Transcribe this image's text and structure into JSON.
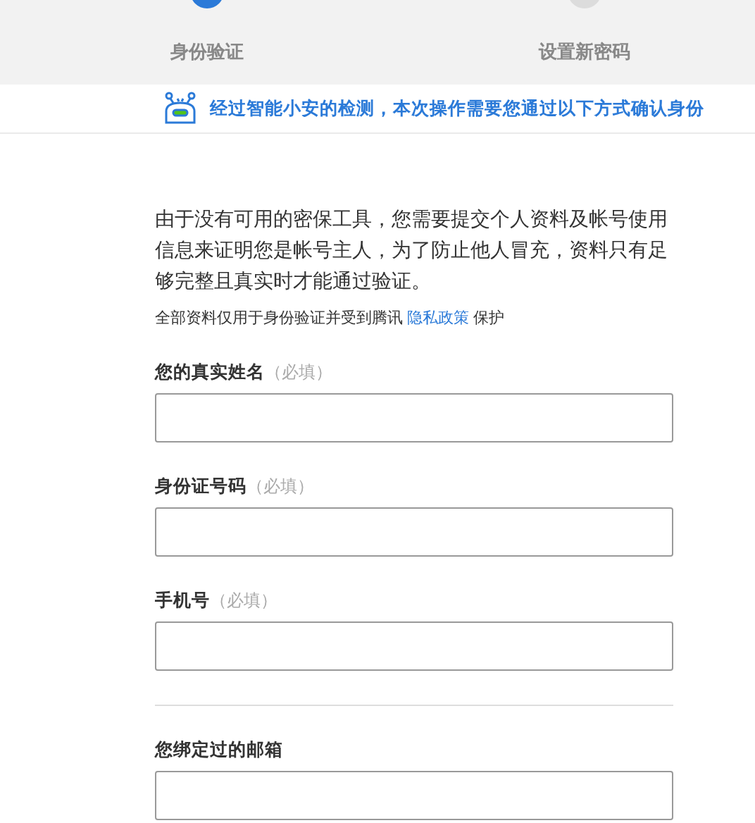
{
  "steps": [
    {
      "label": "身份验证",
      "selected": true
    },
    {
      "label": "设置新密码",
      "selected": false
    }
  ],
  "notice": {
    "text": "经过智能小安的检测，本次操作需要您通过以下方式确认身份"
  },
  "intro": "由于没有可用的密保工具，您需要提交个人资料及帐号使用信息来证明您是帐号主人，为了防止他人冒充，资料只有足够完整且真实时才能通过验证。",
  "privacy": {
    "before": "全部资料仅用于身份验证并受到腾讯",
    "link": "隐私政策",
    "after": "保护"
  },
  "fields": [
    {
      "kind": "field",
      "label": "您的真实姓名",
      "hint": "（必填）"
    },
    {
      "kind": "field",
      "label": "身份证号码",
      "hint": "（必填）"
    },
    {
      "kind": "field",
      "label": "手机号",
      "hint": "（必填）"
    },
    {
      "kind": "divider"
    },
    {
      "kind": "field",
      "label": "您绑定过的邮箱"
    }
  ]
}
